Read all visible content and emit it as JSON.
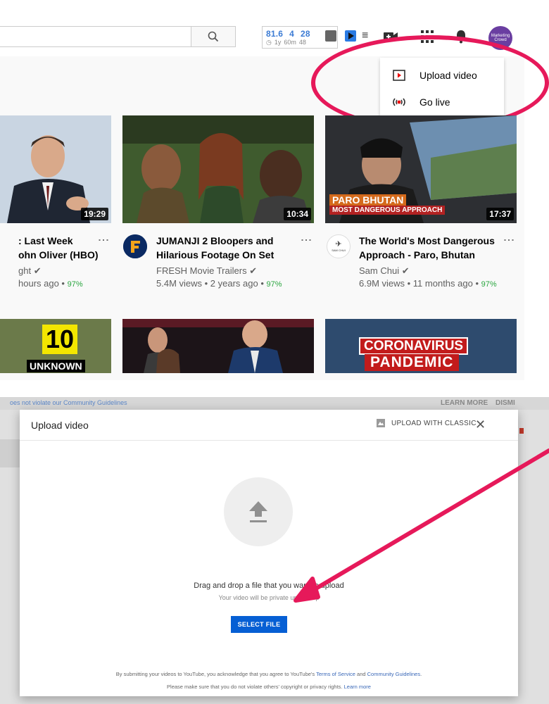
{
  "header": {
    "extension": {
      "values": [
        "81.6",
        "4",
        "28"
      ],
      "subs": [
        "1y",
        "60m",
        "48"
      ]
    },
    "avatar_text": "Marketing Crowd"
  },
  "create_menu": {
    "items": [
      {
        "label": "Upload video",
        "icon": "upload-video-icon"
      },
      {
        "label": "Go live",
        "icon": "go-live-icon"
      }
    ]
  },
  "videos": [
    {
      "title_line1": ": Last Week",
      "title_line2": "ohn Oliver (HBO)",
      "channel": "ght",
      "meta": "hours ago •",
      "pct": "97%",
      "duration": "19:29"
    },
    {
      "title_line1": "JUMANJI 2 Bloopers and",
      "title_line2": "Hilarious Footage On Set",
      "channel": "FRESH Movie Trailers",
      "meta": "5.4M views • 2 years ago •",
      "pct": "97%",
      "duration": "10:34"
    },
    {
      "title_line1": "The World's Most Dangerous",
      "title_line2": "Approach - Paro, Bhutan",
      "channel": "Sam Chui",
      "meta": "6.9M views • 11 months ago •",
      "pct": "97%",
      "duration": "17:37",
      "overlay1": "PARO BHUTAN",
      "overlay2": "MOST DANGEROUS APPROACH",
      "channel_avatar_text": "SAM CHUI"
    }
  ],
  "row2_thumbs": [
    {
      "text1": "10",
      "text2": "UNKNOWN"
    },
    {},
    {
      "text1": "CORONAVIRUS",
      "text2": "PANDEMIC"
    }
  ],
  "upload_dialog": {
    "top_notice": "oes not violate our Community Guidelines",
    "learn_more": "LEARN MORE",
    "dismiss": "DISMI",
    "title": "Upload video",
    "classic_label": "UPLOAD WITH CLASSIC",
    "drag_text": "Drag and drop a file that you want to upload",
    "private_text": "Your video will be private until you p",
    "select_button": "SELECT FILE",
    "legal_line1_pre": "By submitting your videos to YouTube, you acknowledge that you agree to YouTube's",
    "terms_link": "Terms of Service",
    "legal_and": "and",
    "guidelines_link": "Community Guidelines",
    "legal_line2_pre": "Please make sure that you do not violate others' copyright or privacy rights.",
    "learn_more_link": "Learn more"
  },
  "colors": {
    "annotation": "#e6195a",
    "youtube_blue": "#065fd4",
    "rating_green": "#2ba640"
  }
}
